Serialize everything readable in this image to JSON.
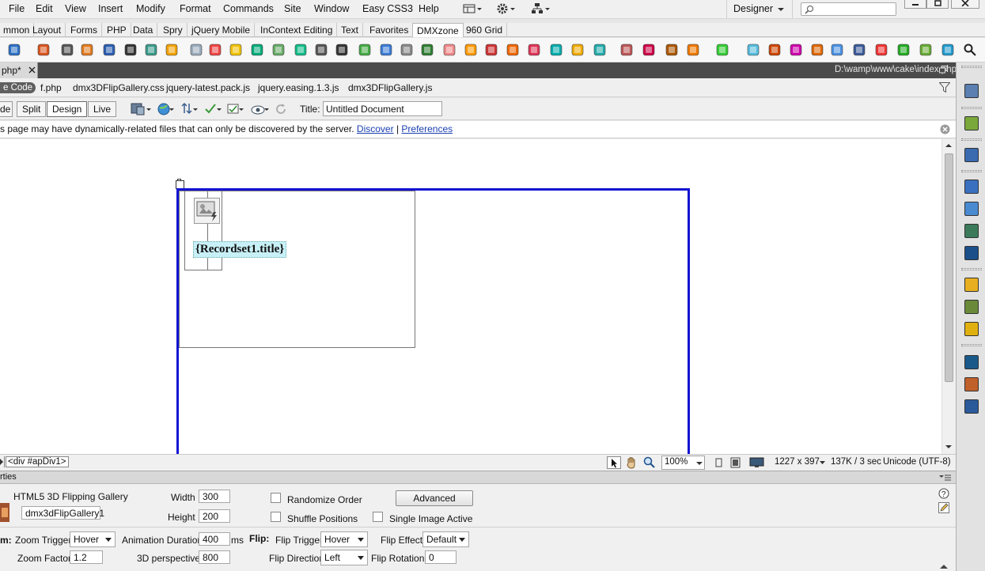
{
  "menubar": {
    "items": [
      "File",
      "Edit",
      "View",
      "Insert",
      "Modify",
      "Format",
      "Commands",
      "Site",
      "Window",
      "Easy CSS3",
      "Help"
    ],
    "workspace": "Designer",
    "window_buttons": [
      "minimize",
      "maximize",
      "close"
    ]
  },
  "insert_tabs": {
    "items": [
      "mmon",
      "Layout",
      "Forms",
      "PHP",
      "Data",
      "Spry",
      "jQuery Mobile",
      "InContext Editing",
      "Text",
      "Favorites",
      "DMXzone",
      "960 Grid"
    ],
    "active": "DMXzone"
  },
  "document": {
    "tab_label": "php*",
    "path": "D:\\wamp\\www\\cake\\index.php",
    "source_code": "e Code",
    "related_files": [
      "f.php",
      "dmx3DFlipGallery.css",
      "jquery-latest.pack.js",
      "jquery.easing.1.3.js",
      "dmx3DFlipGallery.js"
    ],
    "views": [
      "de",
      "Split",
      "Design",
      "Live"
    ],
    "active_view": "Design",
    "title_label": "Title:",
    "title_value": "Untitled Document"
  },
  "infobar": {
    "message": "s page may have dynamically-related files that can only be discovered by the server.",
    "discover": "Discover",
    "separator": "|",
    "preferences": "Preferences"
  },
  "design": {
    "recordset_field": "{Recordset1.title}"
  },
  "statusbar": {
    "tag": "<div #apDiv1>",
    "zoom": "100%",
    "dimensions": "1227 x 397",
    "size_time": "137K / 3 sec",
    "encoding": "Unicode (UTF-8)"
  },
  "properties": {
    "header": "rties",
    "widget_name": "HTML5 3D Flipping Gallery",
    "id_value": "dmx3dFlipGallery1",
    "width_label": "Width",
    "width_value": "300",
    "height_label": "Height",
    "height_value": "200",
    "randomize_label": "Randomize Order",
    "shuffle_label": "Shuffle Positions",
    "single_label": "Single Image Active",
    "advanced_label": "Advanced",
    "zoom_section": "m:",
    "zoom_trigger_label": "Zoom Trigger",
    "zoom_trigger_value": "Hover",
    "anim_duration_label": "Animation Duration",
    "anim_duration_value": "400",
    "anim_unit": "ms",
    "flip_section": "Flip:",
    "flip_trigger_label": "Flip Trigger",
    "flip_trigger_value": "Hover",
    "flip_effect_label": "Flip Effect",
    "flip_effect_value": "Default",
    "zoom_factor_label": "Zoom Factor",
    "zoom_factor_value": "1.2",
    "perspective_label": "3D perspective",
    "perspective_value": "800",
    "flip_direction_label": "Flip Direction",
    "flip_direction_value": "Left",
    "flip_rotation_label": "Flip Rotation",
    "flip_rotation_value": "0"
  },
  "colors": {
    "selection_blue": "#1414d2",
    "recordset_bg": "#c8f0f7",
    "doc_tab_bg": "#4a4a4a",
    "link": "#1a3fb0"
  }
}
